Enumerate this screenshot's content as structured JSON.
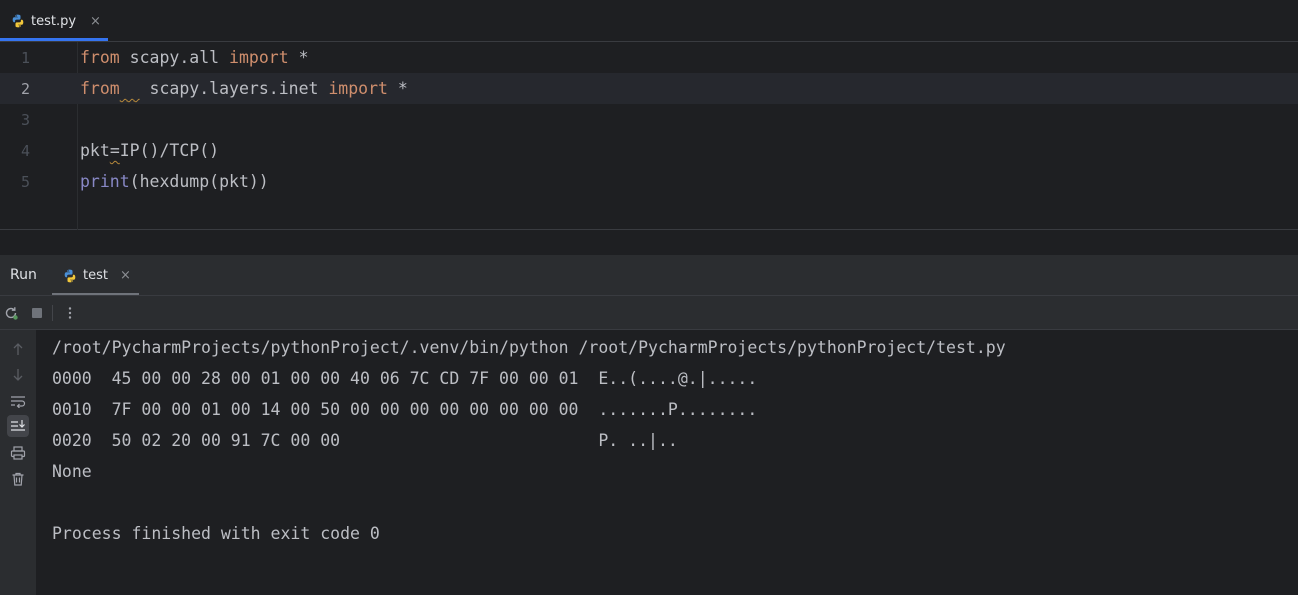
{
  "editor": {
    "tab": {
      "filename": "test.py",
      "close_glyph": "×",
      "icon": "python-file-icon"
    },
    "current_line": 2,
    "lines": [
      {
        "number": "1",
        "tokens": [
          {
            "t": "from",
            "c": "kw"
          },
          {
            "t": " scapy.all ",
            "c": ""
          },
          {
            "t": "import",
            "c": "kw"
          },
          {
            "t": " *",
            "c": ""
          }
        ]
      },
      {
        "number": "2",
        "tokens": [
          {
            "t": "from",
            "c": "kw"
          },
          {
            "t": "  ",
            "c": "squig"
          },
          {
            "t": " scapy.layers.inet ",
            "c": ""
          },
          {
            "t": "import",
            "c": "kw"
          },
          {
            "t": " *",
            "c": ""
          }
        ]
      },
      {
        "number": "3",
        "tokens": []
      },
      {
        "number": "4",
        "tokens": [
          {
            "t": "pkt",
            "c": ""
          },
          {
            "t": "=",
            "c": "squig"
          },
          {
            "t": "IP()/TCP()",
            "c": ""
          }
        ]
      },
      {
        "number": "5",
        "tokens": [
          {
            "t": "print",
            "c": "builtin"
          },
          {
            "t": "(hexdump(pkt))",
            "c": ""
          },
          {
            "t": "",
            "c": ""
          }
        ]
      }
    ]
  },
  "run": {
    "title": "Run",
    "tab_label": "test",
    "close_glyph": "×",
    "toolbar": [
      "rerun-icon",
      "stop-icon",
      "more-options-icon"
    ],
    "side_tools": [
      "scroll-up-icon",
      "scroll-down-icon",
      "soft-wrap-icon",
      "scroll-to-end-icon",
      "print-icon",
      "clear-icon"
    ],
    "console_lines": [
      "/root/PycharmProjects/pythonProject/.venv/bin/python /root/PycharmProjects/pythonProject/test.py",
      "0000  45 00 00 28 00 01 00 00 40 06 7C CD 7F 00 00 01  E..(....@.|.....",
      "0010  7F 00 00 01 00 14 00 50 00 00 00 00 00 00 00 00  .......P........",
      "0020  50 02 20 00 91 7C 00 00                          P. ..|..",
      "None",
      "",
      "Process finished with exit code 0"
    ]
  },
  "colors": {
    "background": "#1e1f22",
    "panel": "#2b2d30",
    "keyword": "#cf8e6d",
    "builtin": "#8888c6",
    "accent": "#3574f0",
    "text": "#bcbec4"
  }
}
